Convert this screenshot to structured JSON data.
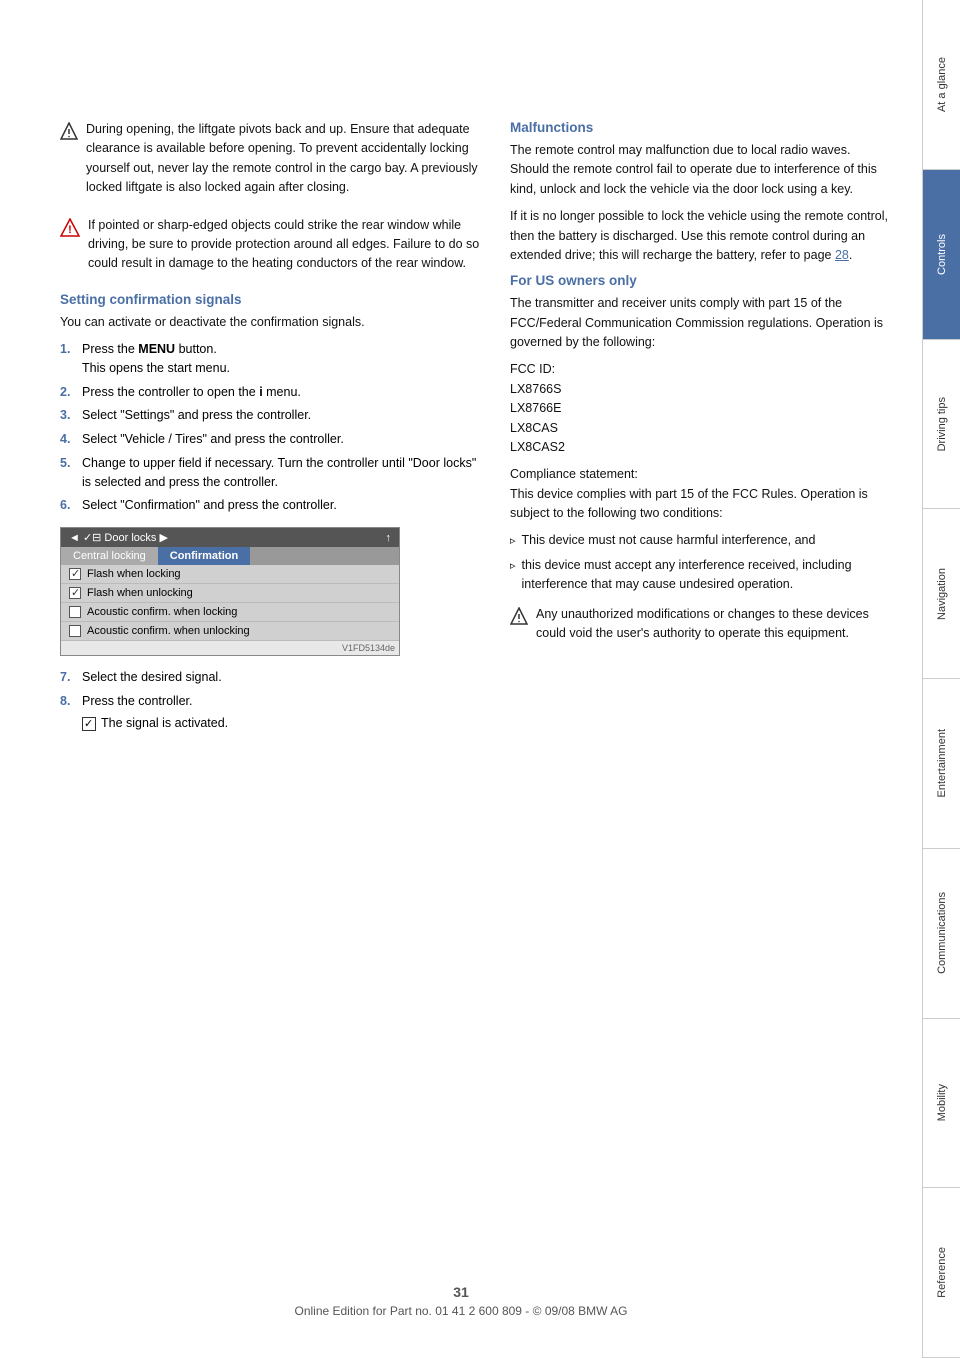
{
  "page": {
    "number": "31",
    "footer_text": "Online Edition for Part no. 01 41 2 600 809 - © 09/08 BMW AG"
  },
  "sidebar": {
    "items": [
      {
        "id": "at-a-glance",
        "label": "At a glance",
        "active": false
      },
      {
        "id": "controls",
        "label": "Controls",
        "active": true
      },
      {
        "id": "driving-tips",
        "label": "Driving tips",
        "active": false
      },
      {
        "id": "navigation",
        "label": "Navigation",
        "active": false
      },
      {
        "id": "entertainment",
        "label": "Entertainment",
        "active": false
      },
      {
        "id": "communications",
        "label": "Communications",
        "active": false
      },
      {
        "id": "mobility",
        "label": "Mobility",
        "active": false
      },
      {
        "id": "reference",
        "label": "Reference",
        "active": false
      }
    ]
  },
  "left_column": {
    "note1": {
      "text": "During opening, the liftgate pivots back and up. Ensure that adequate clearance is available before opening.\nTo prevent accidentally locking yourself out, never lay the remote control in the cargo bay. A previously locked liftgate is also locked again after closing."
    },
    "warning1": {
      "text": "If pointed or sharp-edged objects could strike the rear window while driving, be sure to provide protection around all edges. Failure to do so could result in damage to the heating conductors of the rear window."
    },
    "section_heading": "Setting confirmation signals",
    "section_intro": "You can activate or deactivate the confirmation signals.",
    "steps": [
      {
        "num": "1.",
        "text": "Press the MENU button.\nThis opens the start menu.",
        "bold_part": "MENU"
      },
      {
        "num": "2.",
        "text": "Press the controller to open the i menu."
      },
      {
        "num": "3.",
        "text": "Select \"Settings\" and press the controller."
      },
      {
        "num": "4.",
        "text": "Select \"Vehicle / Tires\" and press the controller."
      },
      {
        "num": "5.",
        "text": "Change to upper field if necessary. Turn the controller until \"Door locks\" is selected and press the controller."
      },
      {
        "num": "6.",
        "text": "Select \"Confirmation\" and press the controller."
      }
    ],
    "menu_screenshot": {
      "top_bar": "◄ ✓⊟ Door locks ▶",
      "top_bar_right": "↑",
      "tabs": [
        {
          "label": "Central locking",
          "active": false
        },
        {
          "label": "Confirmation",
          "active": true
        }
      ],
      "rows": [
        {
          "type": "checked",
          "label": "Flash when locking"
        },
        {
          "type": "checked",
          "label": "Flash when unlocking"
        },
        {
          "type": "empty",
          "label": "Acoustic confirm. when locking"
        },
        {
          "type": "empty",
          "label": "Acoustic confirm. when unlocking"
        }
      ],
      "image_label": "V1FD5134de"
    },
    "steps2": [
      {
        "num": "7.",
        "text": "Select the desired signal."
      },
      {
        "num": "8.",
        "text": "Press the controller.\nThe signal is activated.",
        "check_prefix": true
      }
    ]
  },
  "right_column": {
    "malfunctions": {
      "heading": "Malfunctions",
      "para1": "The remote control may malfunction due to local radio waves. Should the remote control fail to operate due to interference of this kind, unlock and lock the vehicle via the door lock using a key.",
      "para2": "If it is no longer possible to lock the vehicle using the remote control, then the battery is discharged. Use this remote control during an extended drive; this will recharge the battery, refer to page 28.",
      "page_link": "28"
    },
    "for_us_owners": {
      "heading": "For US owners only",
      "para1": "The transmitter and receiver units comply with part 15 of the FCC/Federal Communication Commission regulations. Operation is governed by the following:",
      "fcc_info": [
        "FCC ID:",
        "LX8766S",
        "LX8766E",
        "LX8CAS",
        "LX8CAS2"
      ],
      "compliance_heading": "Compliance statement:",
      "compliance_para": "This device complies with part 15 of the FCC Rules. Operation is subject to the following two conditions:",
      "bullets": [
        "This device must not cause harmful interference, and",
        "this device must accept any interference received, including interference that may cause undesired operation."
      ],
      "note": {
        "text": "Any unauthorized modifications or changes to these devices could void the user's authority to operate this equipment."
      }
    }
  }
}
